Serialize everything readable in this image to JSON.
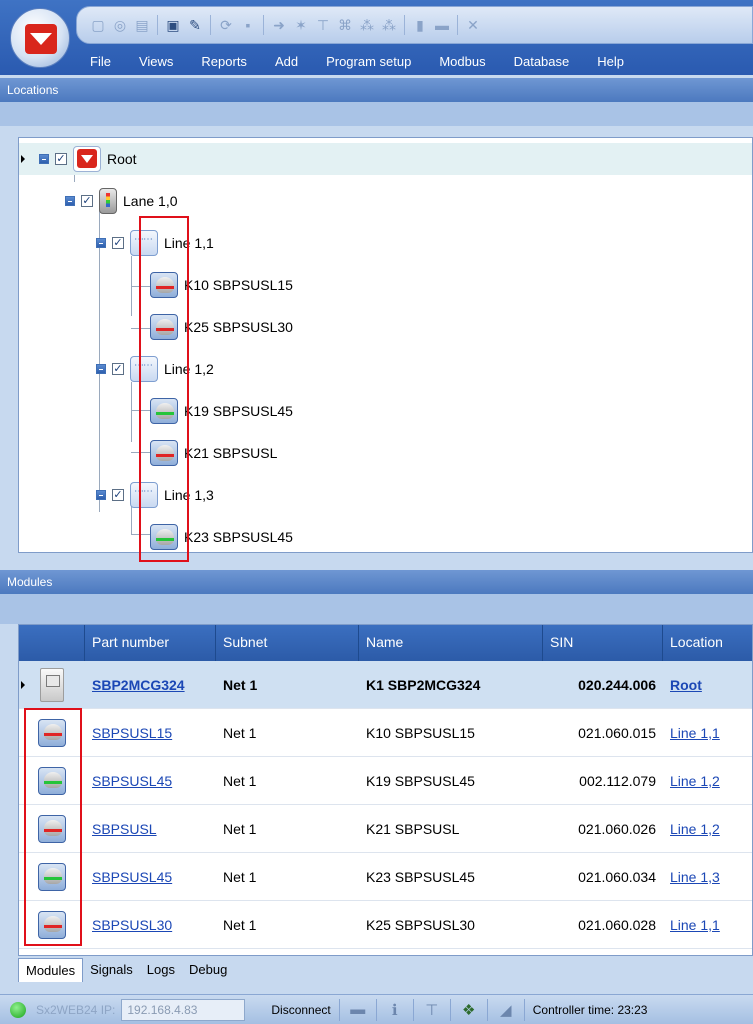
{
  "menu": [
    "File",
    "Views",
    "Reports",
    "Add",
    "Program setup",
    "Modbus",
    "Database",
    "Help"
  ],
  "locations_panel": {
    "title": "Locations"
  },
  "tree": {
    "root": "Root",
    "lane": "Lane 1,0",
    "line1": "Line 1,1",
    "k10": "K10 SBPSUSL15",
    "k25": "K25 SBPSUSL30",
    "line2": "Line 1,2",
    "k19": "K19 SBPSUSL45",
    "k21": "K21 SBPSUSL",
    "line3": "Line 1,3",
    "k23": "K23 SBPSUSL45"
  },
  "modules_panel": {
    "title": "Modules"
  },
  "grid": {
    "headers": [
      "Part number",
      "Subnet",
      "Name",
      "SIN",
      "Location"
    ],
    "rows": [
      {
        "part": "SBP2MCG324",
        "subnet": "Net 1",
        "name": "K1 SBP2MCG324",
        "sin": "020.244.006",
        "location": "Root",
        "icon": "master-module-icon",
        "led": "none"
      },
      {
        "part": "SBPSUSL15",
        "subnet": "Net 1",
        "name": "K10 SBPSUSL15",
        "sin": "021.060.015",
        "location": "Line 1,1",
        "icon": "sensor-icon",
        "led": "red"
      },
      {
        "part": "SBPSUSL45",
        "subnet": "Net 1",
        "name": "K19 SBPSUSL45",
        "sin": "002.112.079",
        "location": "Line 1,2",
        "icon": "sensor-icon",
        "led": "green"
      },
      {
        "part": "SBPSUSL",
        "subnet": "Net 1",
        "name": "K21 SBPSUSL",
        "sin": "021.060.026",
        "location": "Line 1,2",
        "icon": "sensor-icon",
        "led": "red"
      },
      {
        "part": "SBPSUSL45",
        "subnet": "Net 1",
        "name": "K23 SBPSUSL45",
        "sin": "021.060.034",
        "location": "Line 1,3",
        "icon": "sensor-icon",
        "led": "green"
      },
      {
        "part": "SBPSUSL30",
        "subnet": "Net 1",
        "name": "K25 SBPSUSL30",
        "sin": "021.060.028",
        "location": "Line 1,1",
        "icon": "sensor-icon",
        "led": "red"
      }
    ]
  },
  "tabs": [
    "Modules",
    "Signals",
    "Logs",
    "Debug"
  ],
  "status": {
    "device_label": "Sx2WEB24 IP:",
    "ip": "192.168.4.83",
    "disconnect": "Disconnect",
    "controller_time": "Controller time: 23:23"
  },
  "colors": {
    "accent": "#2c5ba8",
    "highlight": "#e0101a",
    "led_red": "#e02525",
    "led_green": "#25c43a"
  }
}
